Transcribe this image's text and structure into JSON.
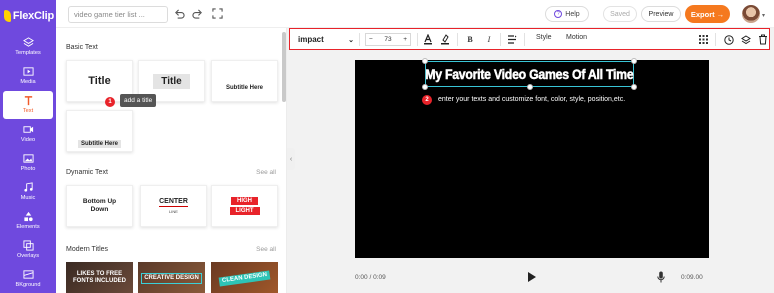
{
  "app": {
    "logo_text": "FlexClip"
  },
  "nav": {
    "items": [
      {
        "label": "Templates",
        "icon": "layers-icon"
      },
      {
        "label": "Media",
        "icon": "media-icon"
      },
      {
        "label": "Text",
        "icon": "text-icon",
        "active": true
      },
      {
        "label": "Video",
        "icon": "video-icon"
      },
      {
        "label": "Photo",
        "icon": "photo-icon"
      },
      {
        "label": "Music",
        "icon": "music-icon"
      },
      {
        "label": "Elements",
        "icon": "elements-icon"
      },
      {
        "label": "Overlays",
        "icon": "overlays-icon"
      },
      {
        "label": "BKground",
        "icon": "background-icon"
      }
    ]
  },
  "topbar": {
    "project_name": "video game tier list ...",
    "help_label": "Help",
    "saved_label": "Saved",
    "preview_label": "Preview",
    "export_label": "Export"
  },
  "panel": {
    "basic_text_title": "Basic Text",
    "basic_cards": [
      "Title",
      "Title",
      "Subtitle Here",
      "Subtitle Here"
    ],
    "tooltip": "add a title",
    "badge_1": "1",
    "dynamic_text_title": "Dynamic Text",
    "see_all": "See all",
    "dynamic_cards": {
      "bottom_up_1": "Bottom Up",
      "bottom_up_2": "Down",
      "center": "CENTER",
      "center_line": "LINE",
      "high": "HIGH",
      "light": "LIGHT"
    },
    "modern_titles_title": "Modern Titles",
    "modern_cards": [
      "LIKES TO FREE FONTS INCLUDED",
      "CREATIVE DESIGN",
      "CLEAN DESIGN"
    ]
  },
  "toolbar": {
    "font": "impact",
    "size": "73",
    "minus": "−",
    "plus": "+",
    "style_label": "Style",
    "motion_label": "Motion"
  },
  "canvas": {
    "title_text": "My Favorite Video Games Of All Time",
    "badge_2": "2",
    "hint": "enter your texts and customize font, color, style, position,etc."
  },
  "player": {
    "current_time": "0:00 / 0:09",
    "total_time": "0:09.00"
  },
  "colors": {
    "nav_bg": "#6f49de",
    "accent_orange": "#f5791f",
    "highlight_red": "#e8232a",
    "selection_cyan": "#39c5d6"
  }
}
